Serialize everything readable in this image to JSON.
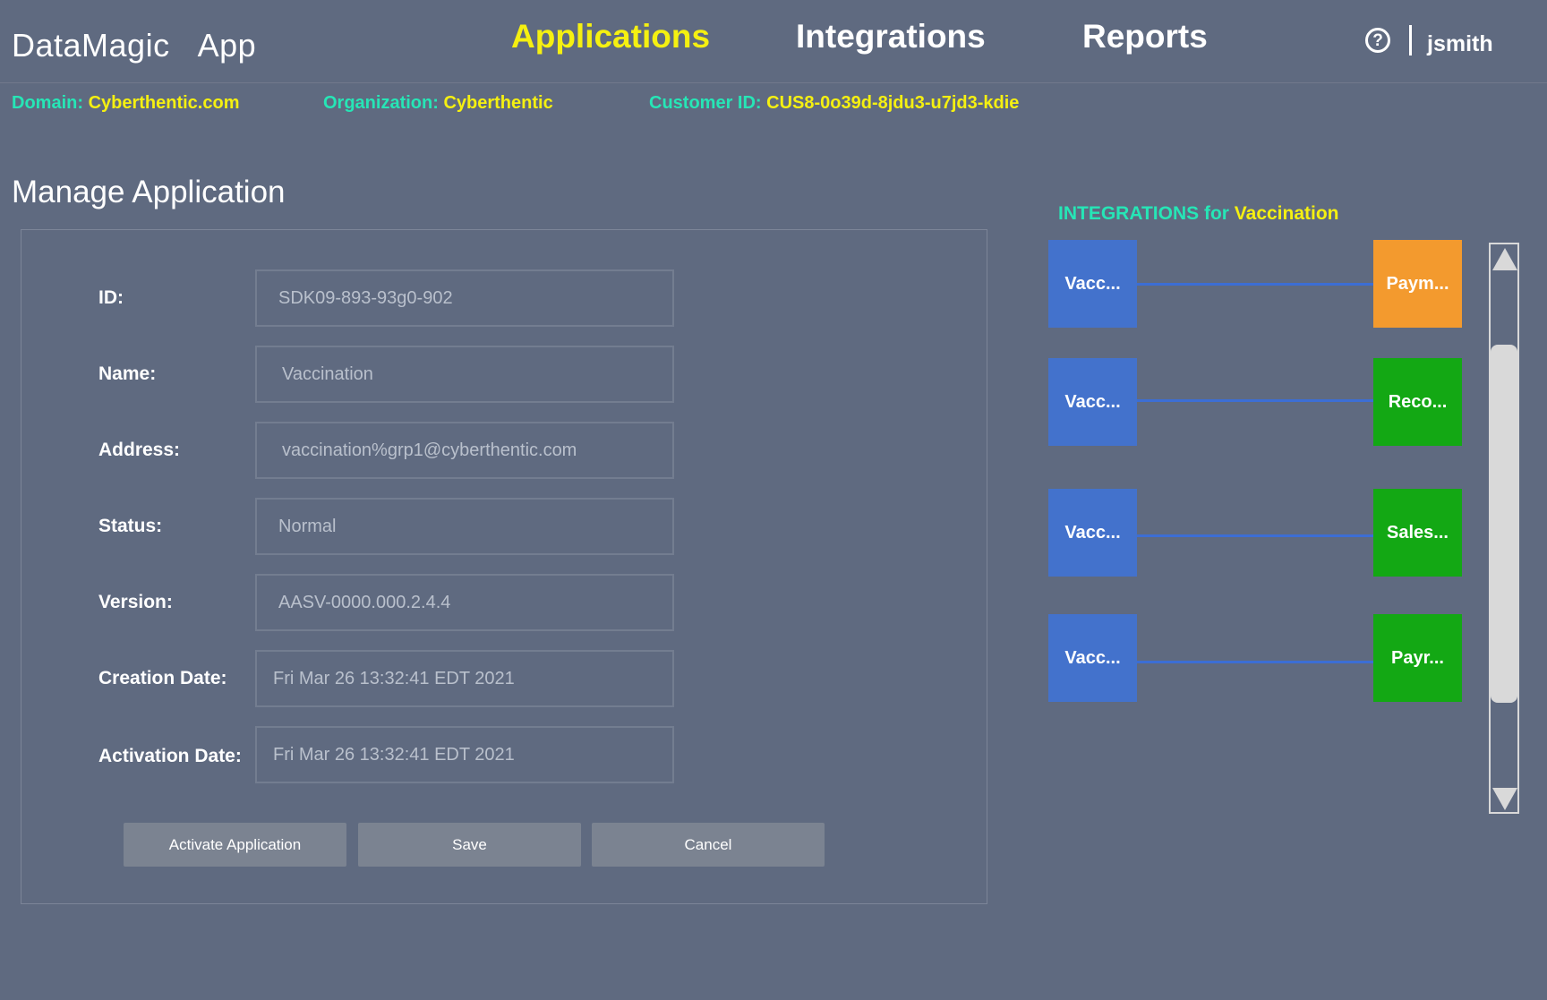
{
  "header": {
    "app_title": "DataMagic  App",
    "nav": {
      "applications": "Applications",
      "integrations": "Integrations",
      "reports": "Reports"
    },
    "help_icon_glyph": "?",
    "username": "jsmith"
  },
  "meta": {
    "domain_label": "Domain:",
    "domain_value": "Cyberthentic.com",
    "org_label": "Organization:",
    "org_value": "Cyberthentic",
    "customer_label": "Customer ID:",
    "customer_value": "CUS8-0o39d-8jdu3-u7jd3-kdie"
  },
  "form": {
    "title": "Manage Application",
    "fields": [
      {
        "label": "ID:",
        "value": "SDK09-893-93g0-902"
      },
      {
        "label": "Name:",
        "value": "Vaccination"
      },
      {
        "label": "Address:",
        "value": "vaccination%grp1@cyberthentic.com"
      },
      {
        "label": "Status:",
        "value": "Normal"
      },
      {
        "label": "Version:",
        "value": "AASV-0000.000.2.4.4"
      },
      {
        "label": "Creation Date:",
        "value": "Fri Mar 26 13:32:41 EDT 2021"
      },
      {
        "label": "Activation Date:",
        "value": "Fri Mar 26 13:32:41 EDT 2021"
      }
    ],
    "buttons": {
      "activate": "Activate Application",
      "save": "Save",
      "cancel": "Cancel"
    }
  },
  "integrations": {
    "title_label": "INTEGRATIONS for",
    "title_value": "Vaccination",
    "rows": [
      {
        "source": "Vacc...",
        "target": "Paym...",
        "target_color": "#f39a2e"
      },
      {
        "source": "Vacc...",
        "target": "Reco...",
        "target_color": "#13a814"
      },
      {
        "source": "Vacc...",
        "target": "Sales...",
        "target_color": "#13a814"
      },
      {
        "source": "Vacc...",
        "target": "Payr...",
        "target_color": "#13a814"
      }
    ]
  },
  "colors": {
    "background": "#5f6a80",
    "accent_yellow": "#f5f011",
    "accent_teal": "#26e6b6",
    "source_node": "#4372cc"
  }
}
